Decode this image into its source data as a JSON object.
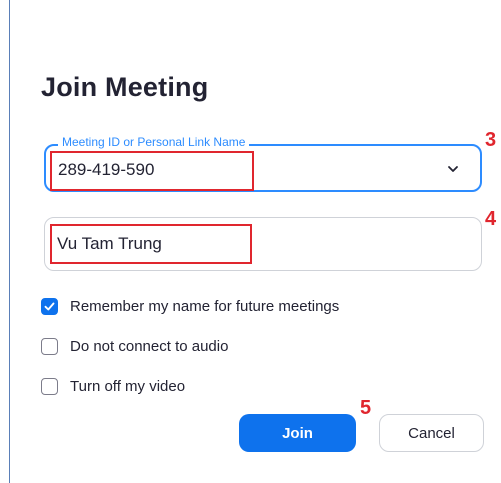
{
  "dialog": {
    "title": "Join Meeting"
  },
  "meeting_id_field": {
    "label": "Meeting ID or Personal Link Name",
    "value": "289-419-590",
    "icon": "chevron-down-icon"
  },
  "name_field": {
    "value": "Vu Tam Trung"
  },
  "options": [
    {
      "label": "Remember my name for future meetings",
      "checked": true
    },
    {
      "label": "Do not connect to audio",
      "checked": false
    },
    {
      "label": "Turn off my video",
      "checked": false
    }
  ],
  "buttons": {
    "join_label": "Join",
    "cancel_label": "Cancel"
  },
  "annotations": {
    "step_3": "3",
    "step_4": "4",
    "step_5": "5"
  },
  "colors": {
    "accent": "#0e72ed",
    "focus_border": "#2d8cff",
    "annotation_red": "#e0262e"
  }
}
